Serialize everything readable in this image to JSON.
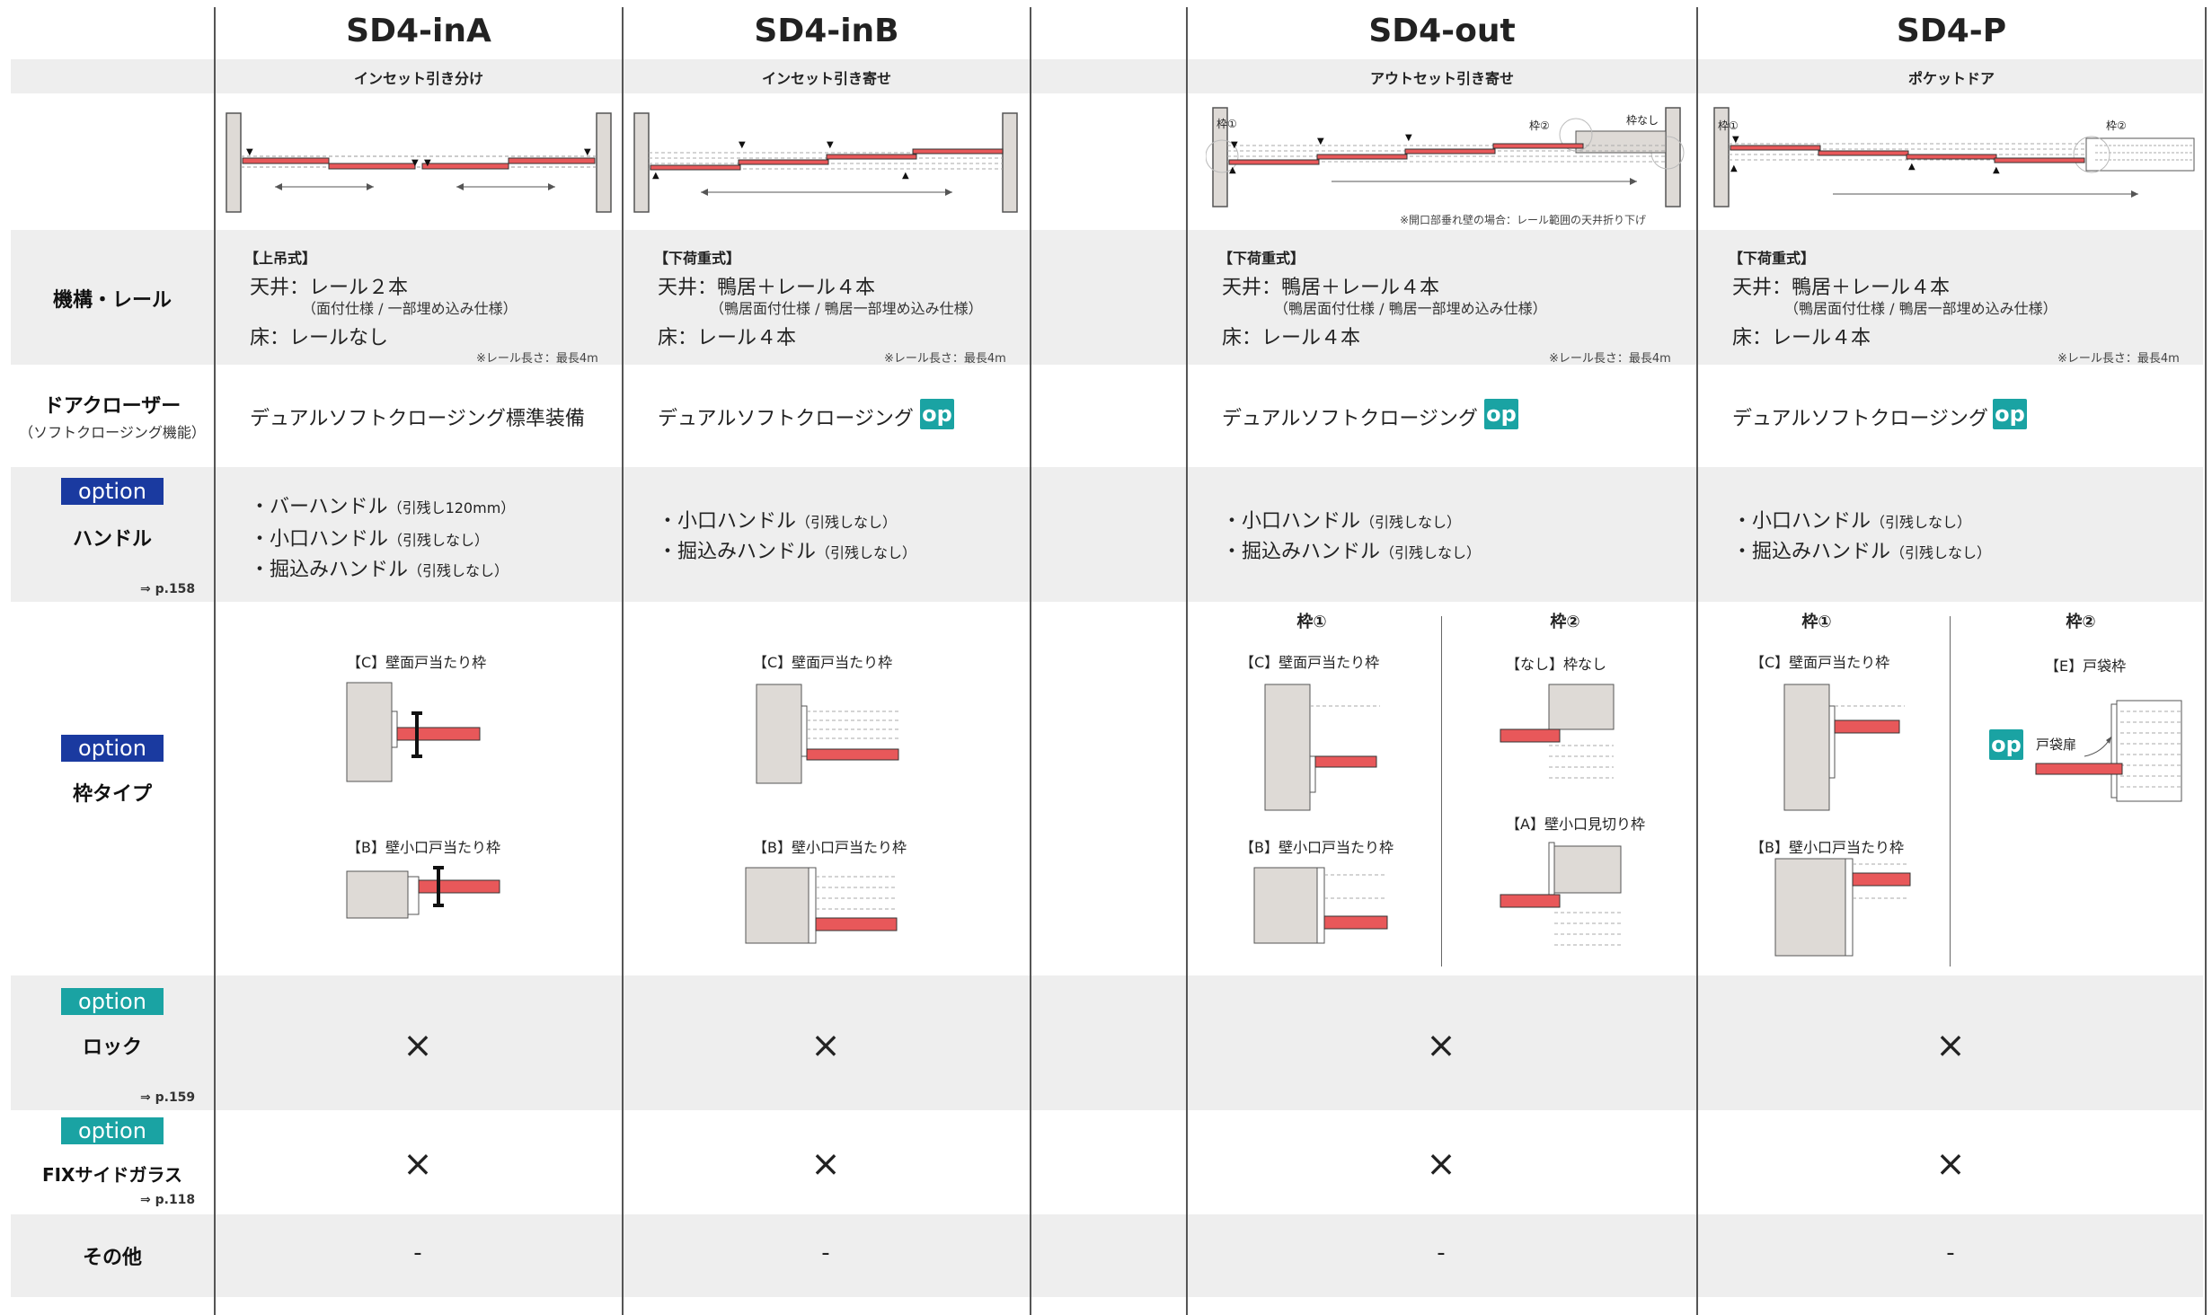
{
  "columns": [
    {
      "title": "SD4-inA",
      "subtitle": "インセット引き分け"
    },
    {
      "title": "SD4-inB",
      "subtitle": "インセット引き寄せ"
    },
    {
      "title": "SD4-out",
      "subtitle": "アウトセット引き寄せ"
    },
    {
      "title": "SD4-P",
      "subtitle": "ポケットドア"
    }
  ],
  "rows": {
    "mechanism": {
      "label": "機構・レール"
    },
    "closer": {
      "label": "ドアクローザー",
      "sub": "（ソフトクロージング機能）"
    },
    "handle": {
      "badge": "option",
      "label": "ハンドル",
      "ref": "⇒ p.158"
    },
    "frame": {
      "badge": "option",
      "label": "枠タイプ"
    },
    "lock": {
      "badge": "option",
      "label": "ロック",
      "ref": "⇒ p.159"
    },
    "glass": {
      "badge": "option",
      "label": "FIXサイドガラス",
      "ref": "⇒ p.118"
    },
    "other": {
      "label": "その他"
    }
  },
  "diagram_labels": {
    "waku1": "枠①",
    "waku2": "枠②",
    "nashi_waku": "枠なし",
    "out_note": "※開口部垂れ壁の場合：レール範囲の天井折り下げ"
  },
  "mechanism": {
    "inA": {
      "type": "【上吊式】",
      "ceiling": "天井：レール２本",
      "ceiling_sub": "（面付仕様 / 一部埋め込み仕様）",
      "floor": "床：レールなし",
      "note": "※レール長さ：最長4m"
    },
    "inB": {
      "type": "【下荷重式】",
      "ceiling": "天井：鴨居＋レール４本",
      "ceiling_sub": "（鴨居面付仕様 / 鴨居一部埋め込み仕様）",
      "floor": "床：レール４本",
      "note": "※レール長さ：最長4m"
    },
    "out": {
      "type": "【下荷重式】",
      "ceiling": "天井：鴨居＋レール４本",
      "ceiling_sub": "（鴨居面付仕様 / 鴨居一部埋め込み仕様）",
      "floor": "床：レール４本",
      "note": "※レール長さ：最長4m"
    },
    "p": {
      "type": "【下荷重式】",
      "ceiling": "天井：鴨居＋レール４本",
      "ceiling_sub": "（鴨居面付仕様 / 鴨居一部埋め込み仕様）",
      "floor": "床：レール４本",
      "note": "※レール長さ：最長4m"
    }
  },
  "closer": {
    "inA": "デュアルソフトクロージング標準装備",
    "inB": "デュアルソフトクロージング",
    "out": "デュアルソフトクロージング",
    "p": "デュアルソフトクロージング",
    "op": "op"
  },
  "handles": {
    "inA": [
      {
        "name": "・バーハンドル",
        "note": "（引残し120mm）"
      },
      {
        "name": "・小口ハンドル",
        "note": "（引残しなし）"
      },
      {
        "name": "・掘込みハンドル",
        "note": "（引残しなし）"
      }
    ],
    "inB": [
      {
        "name": "・小口ハンドル",
        "note": "（引残しなし）"
      },
      {
        "name": "・掘込みハンドル",
        "note": "（引残しなし）"
      }
    ],
    "out": [
      {
        "name": "・小口ハンドル",
        "note": "（引残しなし）"
      },
      {
        "name": "・掘込みハンドル",
        "note": "（引残しなし）"
      }
    ],
    "p": [
      {
        "name": "・小口ハンドル",
        "note": "（引残しなし）"
      },
      {
        "name": "・掘込みハンドル",
        "note": "（引残しなし）"
      }
    ]
  },
  "frames": {
    "C": "【C】壁面戸当たり枠",
    "B": "【B】壁小口戸当たり枠",
    "nashi": "【なし】枠なし",
    "A": "【A】壁小口見切り枠",
    "E": "【E】戸袋枠",
    "tobukuro": "戸袋扉",
    "op": "op"
  },
  "marks": {
    "cross": "×",
    "dash": "-"
  },
  "colors": {
    "navy_badge": "#1a3aa0",
    "teal_badge": "#1aa3a3",
    "door_red": "#e8585a",
    "wall": "#dedad6",
    "band": "#eeeeee"
  }
}
